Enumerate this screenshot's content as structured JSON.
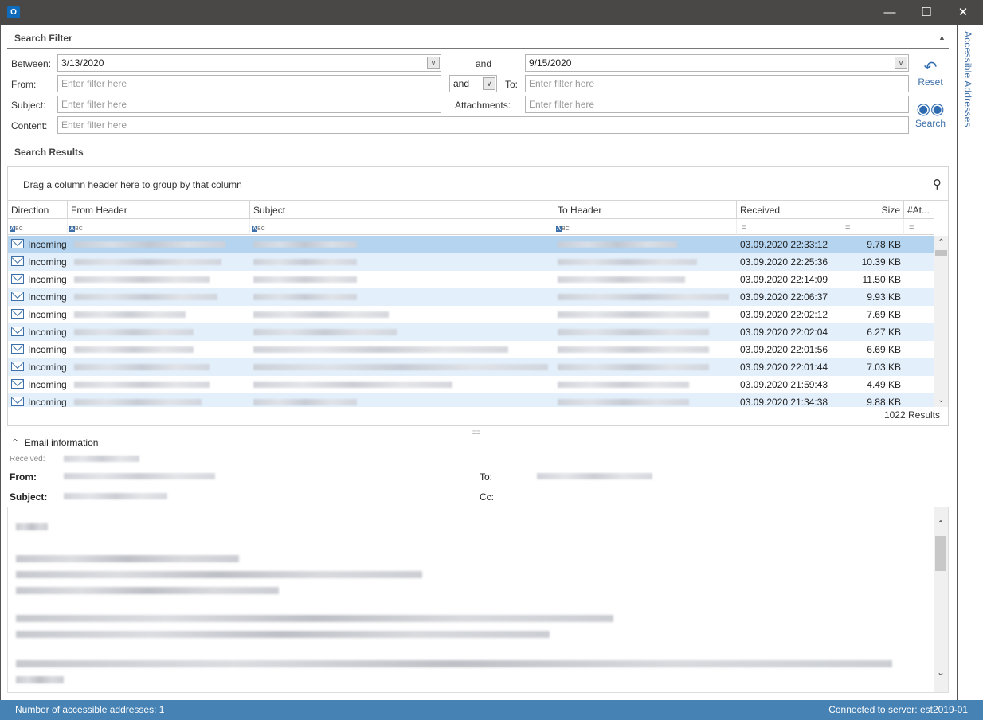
{
  "window": {
    "app_icon": "outlook-icon",
    "controls": {
      "minimize": "—",
      "maximize": "☐",
      "close": "✕"
    }
  },
  "side_panel": {
    "label": "Accessible Addresses"
  },
  "search_filter": {
    "title": "Search Filter",
    "collapse_glyph": "▲",
    "between_label": "Between:",
    "between_from": "3/13/2020",
    "and_label": "and",
    "between_to": "9/15/2020",
    "from_label": "From:",
    "from_placeholder": "Enter filter here",
    "operator_value": "and",
    "to_label": "To:",
    "to_placeholder": "Enter filter here",
    "subject_label": "Subject:",
    "subject_placeholder": "Enter filter here",
    "attachments_label": "Attachments:",
    "attachments_placeholder": "Enter filter here",
    "content_label": "Content:",
    "content_placeholder": "Enter filter here",
    "reset_label": "Reset",
    "search_label": "Search"
  },
  "search_results": {
    "title": "Search Results",
    "group_hint": "Drag a column header here to group by that column",
    "columns": [
      "Direction",
      "From Header",
      "Subject",
      "To Header",
      "Received",
      "Size",
      "#At..."
    ],
    "rows": [
      {
        "direction": "Incoming",
        "received": "03.09.2020 22:33:12",
        "size": "9.78 KB"
      },
      {
        "direction": "Incoming",
        "received": "03.09.2020 22:25:36",
        "size": "10.39 KB"
      },
      {
        "direction": "Incoming",
        "received": "03.09.2020 22:14:09",
        "size": "11.50 KB"
      },
      {
        "direction": "Incoming",
        "received": "03.09.2020 22:06:37",
        "size": "9.93 KB"
      },
      {
        "direction": "Incoming",
        "received": "03.09.2020 22:02:12",
        "size": "7.69 KB"
      },
      {
        "direction": "Incoming",
        "received": "03.09.2020 22:02:04",
        "size": "6.27 KB"
      },
      {
        "direction": "Incoming",
        "received": "03.09.2020 22:01:56",
        "size": "6.69 KB"
      },
      {
        "direction": "Incoming",
        "received": "03.09.2020 22:01:44",
        "size": "7.03 KB"
      },
      {
        "direction": "Incoming",
        "received": "03.09.2020 21:59:43",
        "size": "4.49 KB"
      },
      {
        "direction": "Incoming",
        "received": "03.09.2020 21:34:38",
        "size": "9.88 KB"
      }
    ],
    "count": "1022 Results"
  },
  "email_info": {
    "title": "Email information",
    "received_label": "Received:",
    "from_label": "From:",
    "subject_label": "Subject:",
    "to_label": "To:",
    "cc_label": "Cc:"
  },
  "status": {
    "left": "Number of accessible addresses: 1",
    "right": "Connected to server: est2019-01"
  }
}
